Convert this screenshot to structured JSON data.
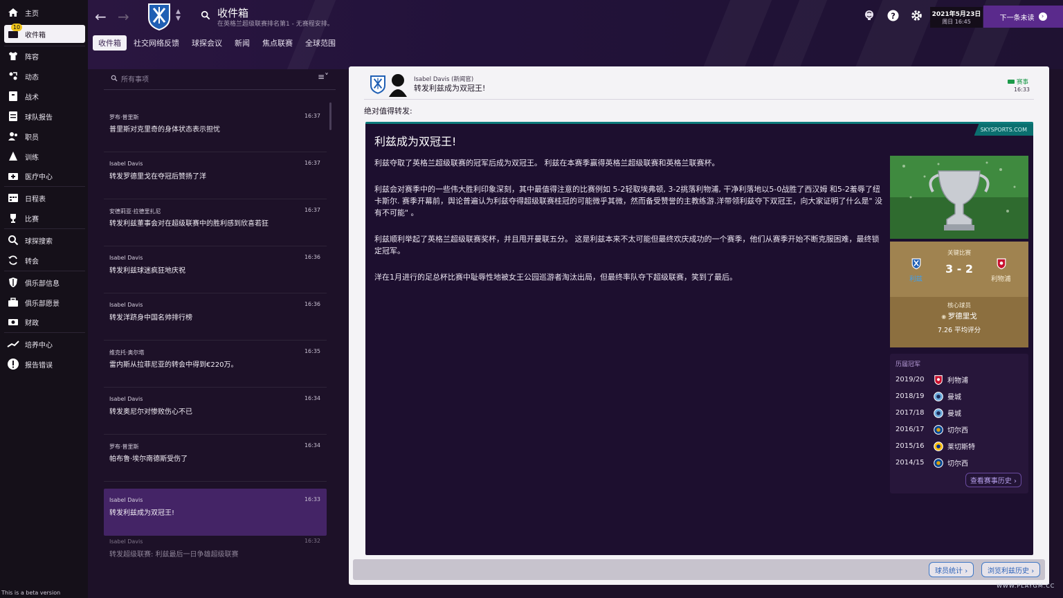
{
  "sidebar": {
    "inbox_badge": "10",
    "items": [
      {
        "label": "主页",
        "icon": "home-icon"
      },
      {
        "label": "收件箱",
        "icon": "inbox-icon"
      },
      {
        "label": "阵容",
        "icon": "shirt-icon"
      },
      {
        "label": "动态",
        "icon": "dynamics-icon"
      },
      {
        "label": "战术",
        "icon": "tactics-icon"
      },
      {
        "label": "球队报告",
        "icon": "report-icon"
      },
      {
        "label": "职员",
        "icon": "staff-icon"
      },
      {
        "label": "训练",
        "icon": "training-icon"
      },
      {
        "label": "医疗中心",
        "icon": "medical-icon"
      },
      {
        "label": "日程表",
        "icon": "calendar-icon"
      },
      {
        "label": "比赛",
        "icon": "trophy-icon"
      },
      {
        "label": "球探搜索",
        "icon": "search-icon"
      },
      {
        "label": "转会",
        "icon": "transfer-icon"
      },
      {
        "label": "俱乐部信息",
        "icon": "shield-icon"
      },
      {
        "label": "俱乐部愿景",
        "icon": "briefcase-icon"
      },
      {
        "label": "财政",
        "icon": "finance-icon"
      },
      {
        "label": "培养中心",
        "icon": "development-icon"
      },
      {
        "label": "报告错误",
        "icon": "alert-icon"
      }
    ],
    "beta_text": "This is a beta version"
  },
  "header": {
    "title": "收件箱",
    "subtitle": "在英格兰超级联赛排名第1 - 无赛程安排。",
    "tabs": [
      "收件箱",
      "社交网络反馈",
      "球探会议",
      "新闻",
      "焦点联赛",
      "全球范围"
    ],
    "date": "2021年5月23日",
    "weekday_time": "周日 16:45",
    "next_button": "下一条未读"
  },
  "list": {
    "search_placeholder": "所有事项",
    "messages": [
      {
        "from": "罗布·普里斯",
        "time": "16:37",
        "subject": "普里斯对克里奇的身体状态表示担忧"
      },
      {
        "from": "Isabel Davis",
        "time": "16:37",
        "subject": "转发罗德里戈在夺冠后赞扬了洋"
      },
      {
        "from": "安德莉亚·拉德里扎尼",
        "time": "16:37",
        "subject": "转发利兹董事会对在超级联赛中的胜利感到欣喜若狂"
      },
      {
        "from": "Isabel Davis",
        "time": "16:36",
        "subject": "转发利兹球迷疯狂地庆祝"
      },
      {
        "from": "Isabel Davis",
        "time": "16:36",
        "subject": "转发洋跻身中国名帅排行榜"
      },
      {
        "from": "维克托·奥尔塔",
        "time": "16:35",
        "subject": "雷内斯从拉菲尼亚的转会中得到€220万。"
      },
      {
        "from": "Isabel Davis",
        "time": "16:34",
        "subject": "转发奥尼尔对惨败伤心不已"
      },
      {
        "from": "罗布·普里斯",
        "time": "16:34",
        "subject": "帕布鲁·埃尔南德斯受伤了"
      },
      {
        "from": "Isabel Davis",
        "time": "16:33",
        "subject": "转发利兹成为双冠王!"
      },
      {
        "from": "Isabel Davis",
        "time": "16:32",
        "subject": "转发超级联赛: 利兹最后一日争雄超级联赛"
      }
    ]
  },
  "message": {
    "sender": "Isabel Davis (新闻官)",
    "subject": "转发利兹成为双冠王!",
    "tag": "赛事",
    "time": "16:33",
    "intro": "绝对值得转发:",
    "source": "SKYSPORTS.COM",
    "article_title": "利兹成为双冠王!",
    "paragraphs": [
      "利兹夺取了英格兰超级联赛的冠军后成为双冠王。 利兹在本赛季赢得英格兰超级联赛和英格兰联赛杯。",
      "利兹会对赛季中的一些伟大胜利印象深刻，其中最值得注意的比赛例如 5-2轻取埃弗顿, 3-2挑落利物浦, 干净利落地以5-0战胜了西汉姆 和5-2羞辱了纽卡斯尔. 赛季开幕前，舆论普遍认为利兹夺得超级联赛桂冠的可能微乎其微，然而备受赞誉的主教练游.洋带领利兹夺下双冠王，向大家证明了什么是\" 没有不可能\" 。",
      "利兹顺利举起了英格兰超级联赛奖杯，并且甩开曼联五分。 这是利兹本来不太可能但最终欢庆成功的一个赛季，他们从赛季开始不断克服困难，最终锁定冠军。",
      "洋在1月进行的足总杯比赛中耻辱性地被女王公园巡游者淘汰出局，但最终率队夺下超级联赛，笑到了最后。"
    ],
    "key_match": {
      "label": "关键比赛",
      "score": "3 - 2",
      "home": "利兹",
      "away": "利物浦",
      "key_player_label": "核心球员",
      "key_player": "罗德里戈",
      "rating": "7.26 平均评分"
    },
    "history": {
      "title": "历届冠军",
      "rows": [
        {
          "season": "2019/20",
          "club": "利物浦",
          "crest": "liverpool-crest-icon"
        },
        {
          "season": "2018/19",
          "club": "曼城",
          "crest": "mancity-crest-icon"
        },
        {
          "season": "2017/18",
          "club": "曼城",
          "crest": "mancity-crest-icon"
        },
        {
          "season": "2016/17",
          "club": "切尔西",
          "crest": "chelsea-crest-icon"
        },
        {
          "season": "2015/16",
          "club": "莱切斯特",
          "crest": "leicester-crest-icon"
        },
        {
          "season": "2014/15",
          "club": "切尔西",
          "crest": "chelsea-crest-icon"
        }
      ],
      "button": "查看赛事历史"
    },
    "bottom_buttons": [
      "球员统计",
      "浏览利兹历史"
    ]
  },
  "watermark": "WWW.PLAYGM.CC",
  "colors": {
    "accent_purple": "#5a2a8c",
    "selected_row": "#442466",
    "article_bg": "#1d0f2f",
    "sky_teal": "#0b6f6f",
    "match_gold": "#8c6f3f",
    "competition_green": "#1c9a4a"
  }
}
